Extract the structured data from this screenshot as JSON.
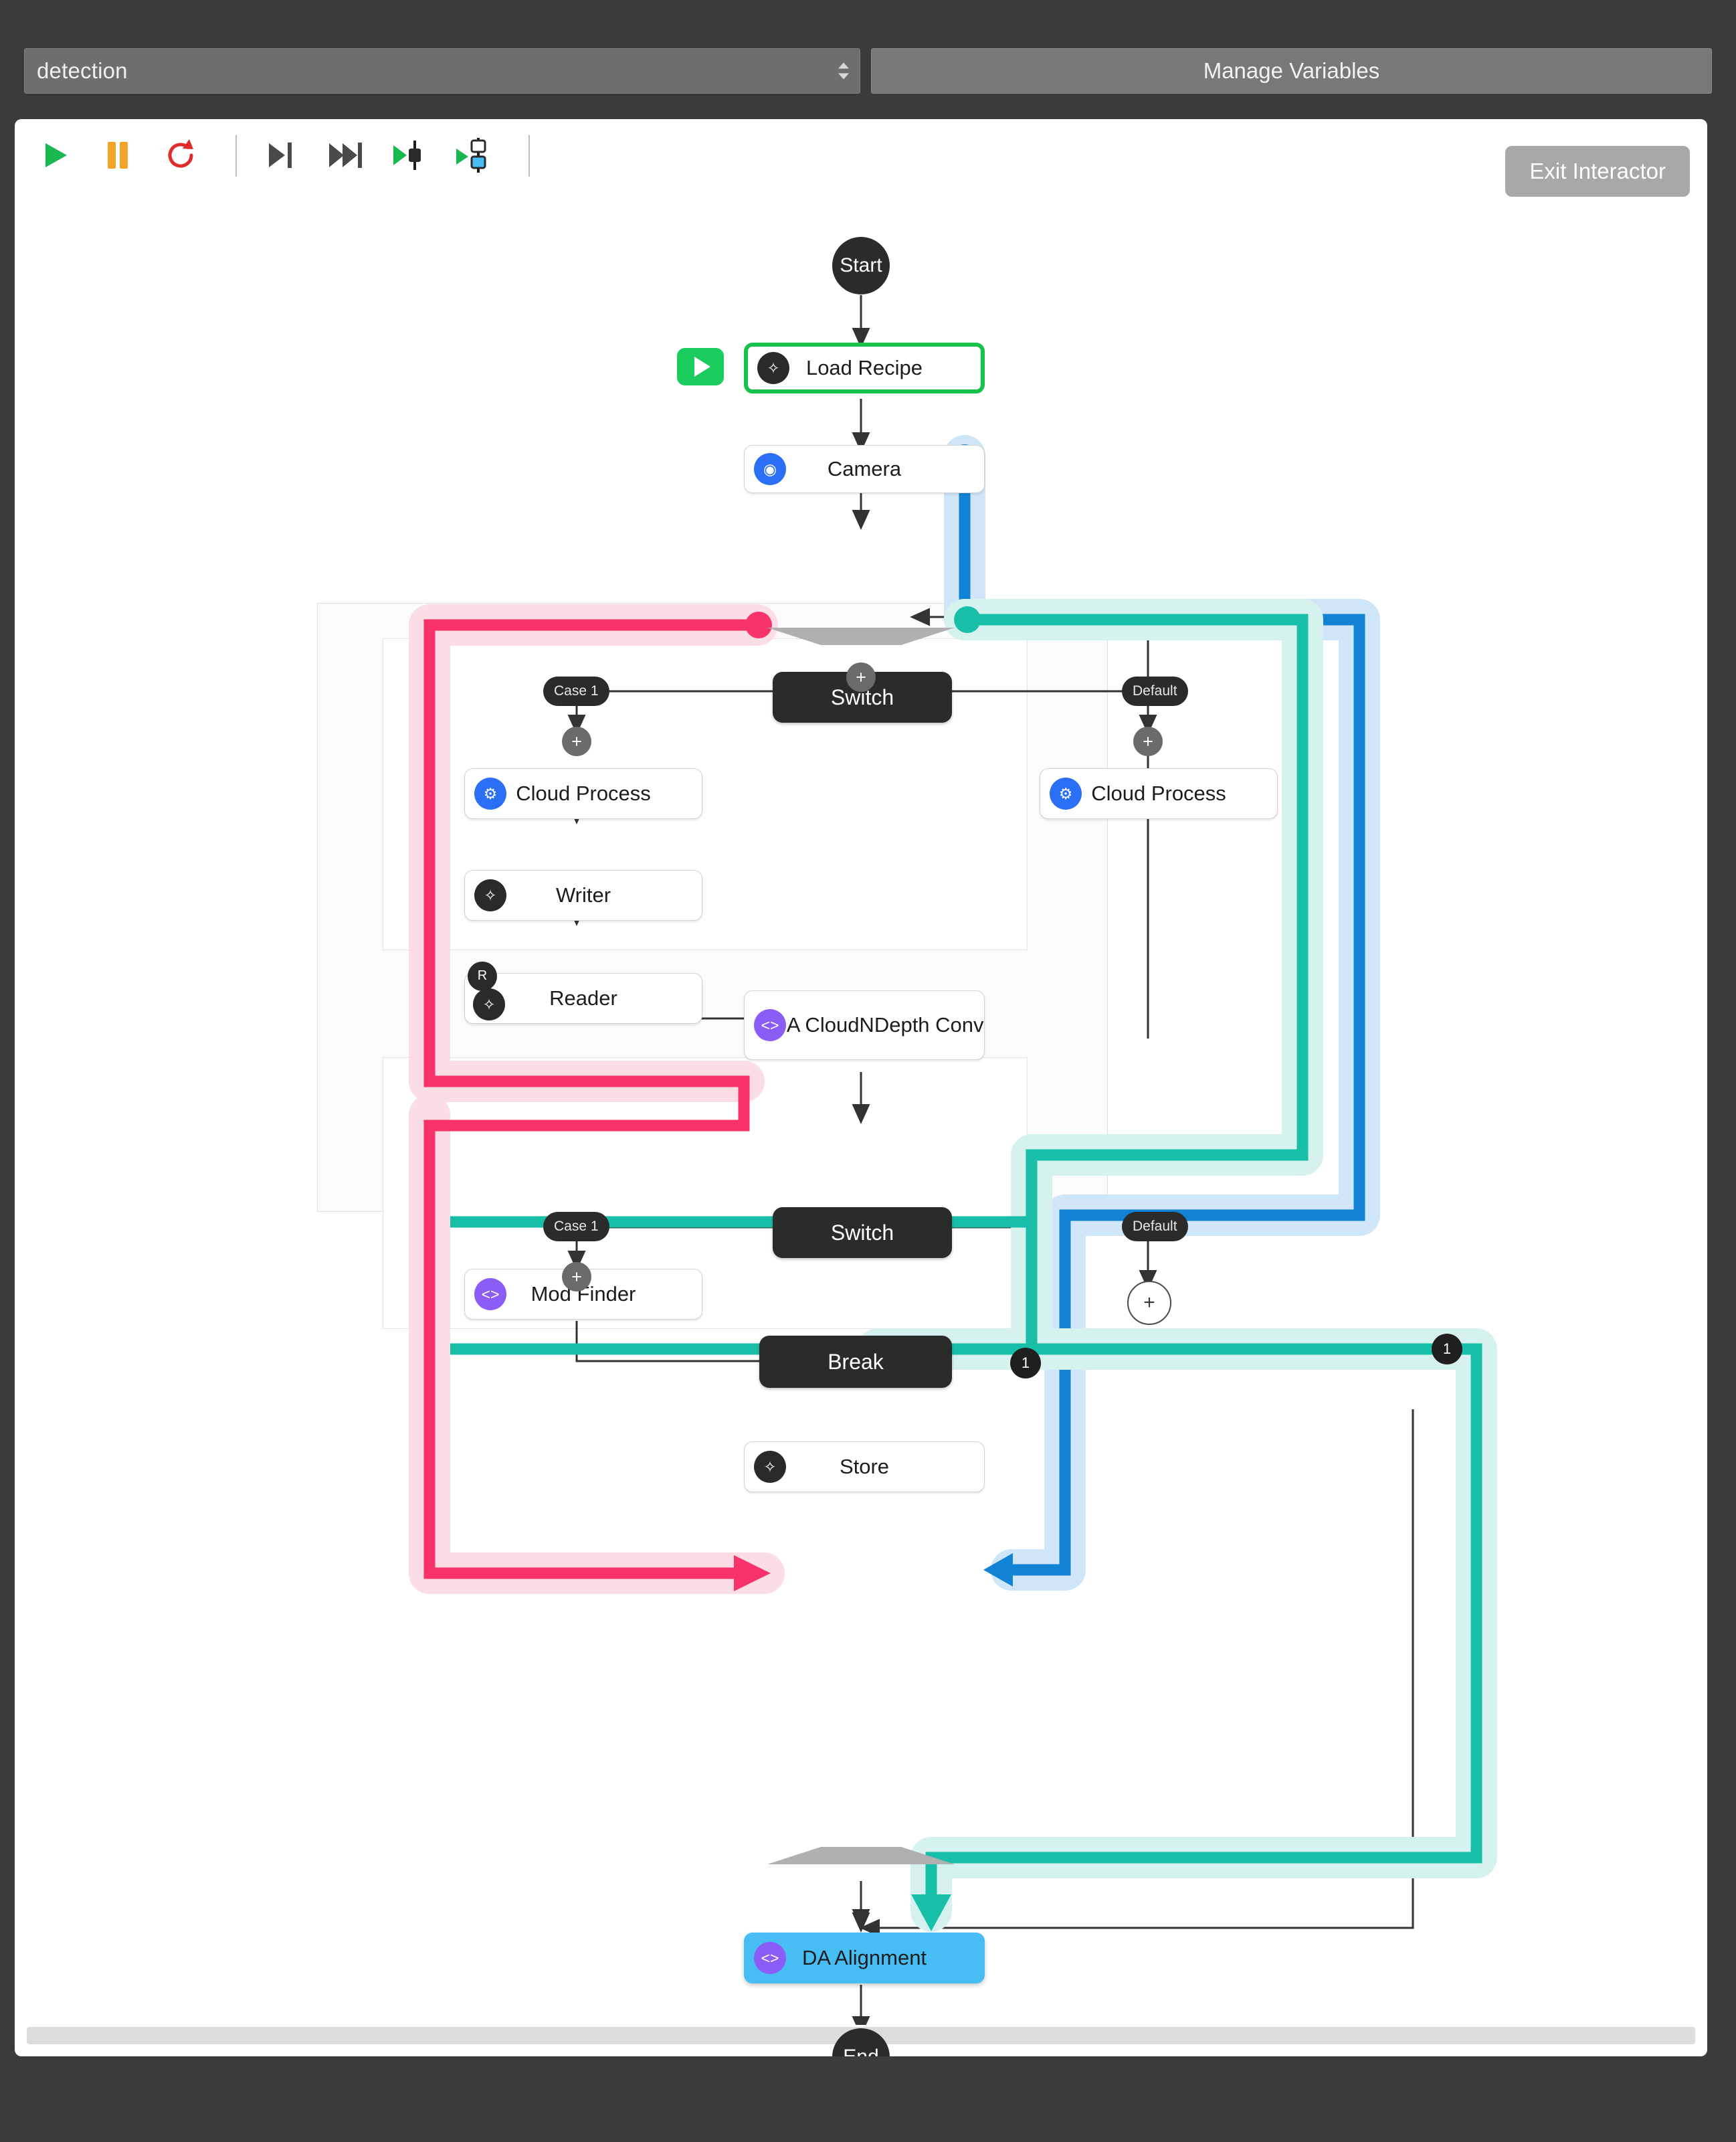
{
  "header": {
    "recipe_value": "detection",
    "recipe_placeholder": "detection",
    "manage_variables_label": "Manage Variables"
  },
  "toolbar": {
    "exit_label": "Exit Interactor",
    "buttons": [
      {
        "name": "run-button",
        "icon": "play-icon",
        "color": "#19b84f"
      },
      {
        "name": "pause-button",
        "icon": "pause-icon",
        "color": "#f6a32a"
      },
      {
        "name": "restart-button",
        "icon": "restart-icon",
        "color": "#e02b2b"
      },
      {
        "name": "step-over-button",
        "icon": "step-over-icon",
        "color": "#4a4a4a"
      },
      {
        "name": "step-forward-button",
        "icon": "step-forward-icon",
        "color": "#4a4a4a"
      },
      {
        "name": "run-to-node-button",
        "icon": "run-to-node-icon",
        "color": "#19b84f"
      },
      {
        "name": "run-to-selected-button",
        "icon": "run-to-selected-icon",
        "color": "#19b84f"
      }
    ]
  },
  "graph": {
    "nodes": {
      "start": {
        "label": "Start"
      },
      "load_recipe": {
        "label": "Load Recipe",
        "icon": "wrench-icon",
        "icon_color": "#2a2a2a"
      },
      "camera": {
        "label": "Camera",
        "icon": "camera-icon",
        "icon_color": "#2a6ff5"
      },
      "switch1": {
        "label": "Switch"
      },
      "case1_a": {
        "label": "Case 1"
      },
      "default_a": {
        "label": "Default"
      },
      "cloud_left": {
        "label": "Cloud Process",
        "icon": "cloud-icon",
        "icon_color": "#2a6ff5"
      },
      "cloud_right": {
        "label": "Cloud Process",
        "icon": "cloud-icon",
        "icon_color": "#2a6ff5"
      },
      "writer": {
        "label": "Writer",
        "icon": "wrench-icon",
        "icon_color": "#2a2a2a"
      },
      "reader": {
        "label": "Reader",
        "icon": "wrench-icon",
        "icon_color": "#2a2a2a",
        "flag": "R"
      },
      "da_cloud": {
        "label": "DA CloudNDepth Conv",
        "icon": "code-icon",
        "icon_color": "#8b5cf6"
      },
      "switch2": {
        "label": "Switch"
      },
      "case1_b": {
        "label": "Case 1"
      },
      "default_b": {
        "label": "Default"
      },
      "mod_finder": {
        "label": "Mod Finder",
        "icon": "code-icon",
        "icon_color": "#8b5cf6"
      },
      "break": {
        "label": "Break"
      },
      "store": {
        "label": "Store",
        "icon": "wrench-icon",
        "icon_color": "#2a2a2a"
      },
      "da_alignment": {
        "label": "DA Alignment",
        "icon": "code-icon",
        "icon_color": "#8b5cf6"
      },
      "end": {
        "label": "End"
      }
    },
    "add_badge_label": "+",
    "break_out_badge": "1",
    "loop_out_badge": "1",
    "flow_colors": {
      "pink": "#f8326a",
      "teal": "#18bfa8",
      "blue": "#1283d4",
      "green": "#19cc5b",
      "selected_node": "#48bdf4"
    }
  }
}
